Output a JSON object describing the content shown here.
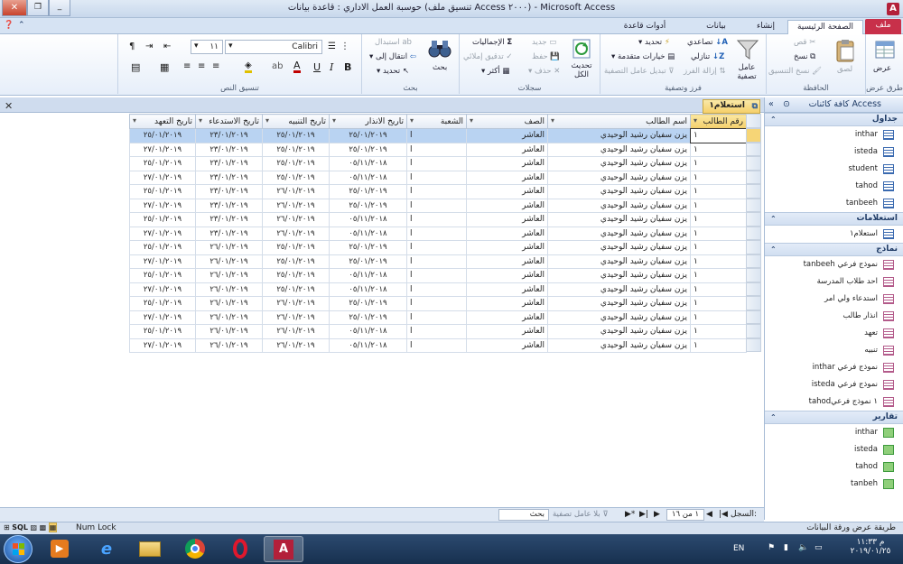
{
  "window": {
    "title": "حوسبة العمل الاداري : قاعدة بيانات (تنسيق ملف Access ٢٠٠٠) - Microsoft Access"
  },
  "tabs": {
    "file": "ملف",
    "home": "الصفحة الرئيسية",
    "create": "إنشاء",
    "external": "بيانات خارجية",
    "dbtools": "أدوات قاعدة البيانات"
  },
  "ribbon": {
    "views_label": "عرض",
    "views_group": "طرق عرض",
    "paste": "لصق",
    "cut": "قص",
    "copy": "نسخ",
    "format_painter": "نسخ التنسيق",
    "clipboard_group": "الحافظة",
    "filter": "عامل تصفية",
    "ascending": "تصاعدي",
    "descending": "تنازلي",
    "remove_sort": "إزالة الفرز",
    "selection": "تحديد",
    "advanced": "خيارات متقدمة",
    "toggle_filter": "تبديل عامل التصفية",
    "sortfilter_group": "فرز وتصفية",
    "refresh_all": "تحديث الكل",
    "new": "جديد",
    "save": "حفظ",
    "delete": "حذف",
    "totals": "الإجماليات",
    "spelling": "تدقيق إملائي",
    "more": "أكثر",
    "records_group": "سجلات",
    "find": "بحث",
    "replace": "استبدال",
    "goto": "انتقال إلى",
    "select": "تحديد",
    "find_group": "بحث",
    "font_name": "Calibri",
    "font_size": "١١",
    "textformat_group": "تنسيق النص"
  },
  "nav": {
    "title": "كافة كائنات Access",
    "sections": [
      {
        "label": "جداول",
        "items": [
          "inthar",
          "isteda",
          "student",
          "tahod",
          "tanbeeh"
        ]
      },
      {
        "label": "استعلامات",
        "items": [
          "استعلام١"
        ]
      },
      {
        "label": "نماذج",
        "items": [
          "tanbeeh نموذج فرعي",
          "احد طلاب المدرسة",
          "استدعاء ولي امر",
          "انذار طالب",
          "تعهد",
          "تنبيه",
          "inthar نموذج فرعي",
          "isteda نموذج فرعي",
          "tahod١ نموذج فرعي"
        ]
      },
      {
        "label": "تقارير",
        "items": [
          "inthar",
          "isteda",
          "tahod",
          "tanbeh"
        ]
      }
    ]
  },
  "doc": {
    "tab": "استعلام١"
  },
  "grid": {
    "columns": [
      "رقم الطالب",
      "اسم الطالب",
      "الصف",
      "الشعبة",
      "تاريخ الانذار",
      "تاريخ التنبيه",
      "تاريخ الاستدعاء",
      "تاريخ التعهد"
    ],
    "rows": [
      [
        "١",
        "يزن سفيان رشيد الوحيدي",
        "العاشر",
        "ا",
        "٢٥/٠١/٢٠١٩",
        "٢٥/٠١/٢٠١٩",
        "٢٣/٠١/٢٠١٩",
        "٢٥/٠١/٢٠١٩"
      ],
      [
        "١",
        "يزن سفيان رشيد الوحيدي",
        "العاشر",
        "ا",
        "٢٥/٠١/٢٠١٩",
        "٢٥/٠١/٢٠١٩",
        "٢٣/٠١/٢٠١٩",
        "٢٧/٠١/٢٠١٩"
      ],
      [
        "١",
        "يزن سفيان رشيد الوحيدي",
        "العاشر",
        "ا",
        "٠٥/١١/٢٠١٨",
        "٢٥/٠١/٢٠١٩",
        "٢٣/٠١/٢٠١٩",
        "٢٥/٠١/٢٠١٩"
      ],
      [
        "١",
        "يزن سفيان رشيد الوحيدي",
        "العاشر",
        "ا",
        "٠٥/١١/٢٠١٨",
        "٢٥/٠١/٢٠١٩",
        "٢٣/٠١/٢٠١٩",
        "٢٧/٠١/٢٠١٩"
      ],
      [
        "١",
        "يزن سفيان رشيد الوحيدي",
        "العاشر",
        "ا",
        "٢٥/٠١/٢٠١٩",
        "٢٦/٠١/٢٠١٩",
        "٢٣/٠١/٢٠١٩",
        "٢٥/٠١/٢٠١٩"
      ],
      [
        "١",
        "يزن سفيان رشيد الوحيدي",
        "العاشر",
        "ا",
        "٢٥/٠١/٢٠١٩",
        "٢٦/٠١/٢٠١٩",
        "٢٣/٠١/٢٠١٩",
        "٢٧/٠١/٢٠١٩"
      ],
      [
        "١",
        "يزن سفيان رشيد الوحيدي",
        "العاشر",
        "ا",
        "٠٥/١١/٢٠١٨",
        "٢٦/٠١/٢٠١٩",
        "٢٣/٠١/٢٠١٩",
        "٢٥/٠١/٢٠١٩"
      ],
      [
        "١",
        "يزن سفيان رشيد الوحيدي",
        "العاشر",
        "ا",
        "٠٥/١١/٢٠١٨",
        "٢٦/٠١/٢٠١٩",
        "٢٣/٠١/٢٠١٩",
        "٢٧/٠١/٢٠١٩"
      ],
      [
        "١",
        "يزن سفيان رشيد الوحيدي",
        "العاشر",
        "ا",
        "٢٥/٠١/٢٠١٩",
        "٢٥/٠١/٢٠١٩",
        "٢٦/٠١/٢٠١٩",
        "٢٥/٠١/٢٠١٩"
      ],
      [
        "١",
        "يزن سفيان رشيد الوحيدي",
        "العاشر",
        "ا",
        "٢٥/٠١/٢٠١٩",
        "٢٥/٠١/٢٠١٩",
        "٢٦/٠١/٢٠١٩",
        "٢٧/٠١/٢٠١٩"
      ],
      [
        "١",
        "يزن سفيان رشيد الوحيدي",
        "العاشر",
        "ا",
        "٠٥/١١/٢٠١٨",
        "٢٥/٠١/٢٠١٩",
        "٢٦/٠١/٢٠١٩",
        "٢٥/٠١/٢٠١٩"
      ],
      [
        "١",
        "يزن سفيان رشيد الوحيدي",
        "العاشر",
        "ا",
        "٠٥/١١/٢٠١٨",
        "٢٥/٠١/٢٠١٩",
        "٢٦/٠١/٢٠١٩",
        "٢٧/٠١/٢٠١٩"
      ],
      [
        "١",
        "يزن سفيان رشيد الوحيدي",
        "العاشر",
        "ا",
        "٢٥/٠١/٢٠١٩",
        "٢٦/٠١/٢٠١٩",
        "٢٦/٠١/٢٠١٩",
        "٢٥/٠١/٢٠١٩"
      ],
      [
        "١",
        "يزن سفيان رشيد الوحيدي",
        "العاشر",
        "ا",
        "٢٥/٠١/٢٠١٩",
        "٢٦/٠١/٢٠١٩",
        "٢٦/٠١/٢٠١٩",
        "٢٧/٠١/٢٠١٩"
      ],
      [
        "١",
        "يزن سفيان رشيد الوحيدي",
        "العاشر",
        "ا",
        "٠٥/١١/٢٠١٨",
        "٢٦/٠١/٢٠١٩",
        "٢٦/٠١/٢٠١٩",
        "٢٥/٠١/٢٠١٩"
      ],
      [
        "١",
        "يزن سفيان رشيد الوحيدي",
        "العاشر",
        "ا",
        "٠٥/١١/٢٠١٨",
        "٢٦/٠١/٢٠١٩",
        "٢٦/٠١/٢٠١٩",
        "٢٧/٠١/٢٠١٩"
      ]
    ]
  },
  "recordnav": {
    "label": "السجل:",
    "position": "١ من ١٦",
    "no_filter": "بلا عامل تصفية",
    "search": "بحث"
  },
  "status": {
    "left": "طريقة عرض ورقة البيانات",
    "numlock": "Num Lock",
    "sql": "SQL"
  },
  "taskbar": {
    "lang": "EN",
    "time": "م ١١:٣٣",
    "date": "٢٠١٩/٠١/٢٥"
  }
}
